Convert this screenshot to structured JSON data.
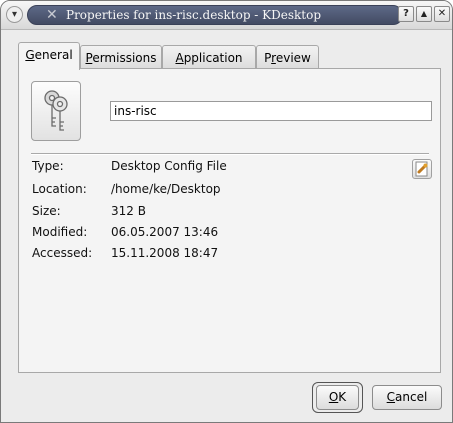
{
  "window": {
    "title": "Properties for ins-risc.desktop - KDesktop",
    "menu_icon": "chevron-down-icon",
    "lock_icon": "cross-icon",
    "buttons": [
      {
        "name": "help-icon",
        "glyph": "?"
      },
      {
        "name": "maximize-icon",
        "glyph": "▲"
      },
      {
        "name": "close-icon",
        "glyph": "✕"
      }
    ]
  },
  "tabs": [
    {
      "pre": "",
      "key": "G",
      "post": "eneral",
      "active": true
    },
    {
      "pre": "",
      "key": "P",
      "post": "ermissions",
      "active": false
    },
    {
      "pre": "",
      "key": "A",
      "post": "pplication",
      "active": false
    },
    {
      "pre": "P",
      "key": "r",
      "post": "eview",
      "active": false
    }
  ],
  "general": {
    "icon": "keys-icon",
    "name_value": "ins-risc",
    "type_label": "Type:",
    "type_value": "Desktop Config File",
    "location_label": "Location:",
    "location_value": "/home/ke/Desktop",
    "size_label": "Size:",
    "size_value": "312 B",
    "modified_label": "Modified:",
    "modified_value": "06.05.2007 13:46",
    "accessed_label": "Accessed:",
    "accessed_value": "15.11.2008 18:47"
  },
  "buttons": {
    "ok": {
      "key": "O",
      "post": "K"
    },
    "cancel": {
      "key": "C",
      "post": "ancel"
    }
  },
  "colors": {
    "title_bar": "#4a536c",
    "title_text": "#f6f6f6",
    "panel_bg": "#f4f4f4"
  }
}
